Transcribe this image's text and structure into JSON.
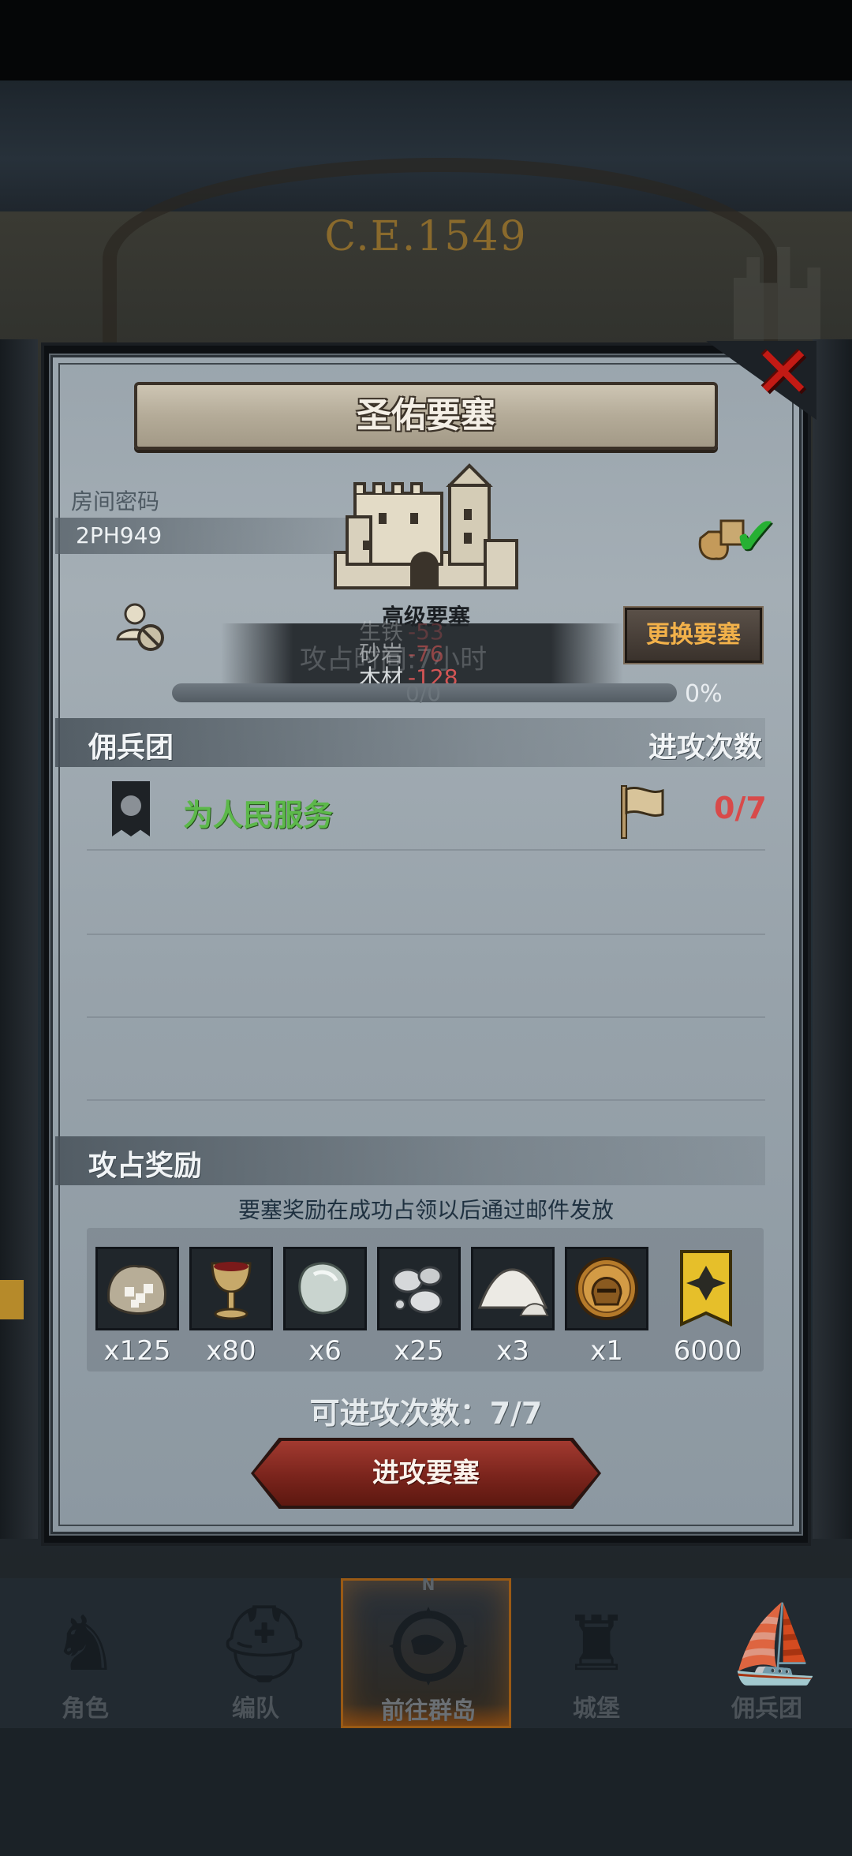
{
  "background": {
    "year_text": "C.E.1549"
  },
  "dialog": {
    "title": "圣佑要塞",
    "close_icon": "close-x-icon",
    "room_password_label": "房间密码",
    "room_password_value": "2PH949",
    "fortress_level_label": "高级要塞",
    "resources": [
      {
        "name": "生铁",
        "value": "-53"
      },
      {
        "name": "砂岩",
        "value": "-76"
      },
      {
        "name": "木材",
        "value": "-128"
      }
    ],
    "occupy_hint_text": "攻占时间:7小时",
    "swap_button_label": "更换要塞",
    "progress": {
      "text": "0/0",
      "percent_label": "0%",
      "fraction": 0
    },
    "mercenary_section": {
      "title": "佣兵团",
      "attack_count_title": "进攻次数",
      "items": [
        {
          "name": "为人民服务",
          "attack_count": "0/7"
        }
      ]
    },
    "rewards_section": {
      "title": "攻占奖励",
      "note": "要塞奖励在成功占领以后通过邮件发放",
      "items": [
        {
          "icon": "sugar-sack-icon",
          "qty": "x125"
        },
        {
          "icon": "wine-goblet-icon",
          "qty": "x80"
        },
        {
          "icon": "moonstone-icon",
          "qty": "x6"
        },
        {
          "icon": "silver-pearls-icon",
          "qty": "x25"
        },
        {
          "icon": "salt-pile-icon",
          "qty": "x3"
        },
        {
          "icon": "knight-helmet-medal-icon",
          "qty": "x1"
        },
        {
          "icon": "guild-banner-icon",
          "qty": "6000"
        }
      ]
    },
    "attacks_left_text": "可进攻次数：7/7",
    "attack_button_label": "进攻要塞"
  },
  "bottom_nav": {
    "compass_letter": "N",
    "items": [
      {
        "label": "角色",
        "icon": "knight-icon",
        "active": false
      },
      {
        "label": "编队",
        "icon": "helmet-icon",
        "active": false
      },
      {
        "label": "前往群岛",
        "icon": "compass-globe-icon",
        "active": true
      },
      {
        "label": "城堡",
        "icon": "castle-icon",
        "active": false
      },
      {
        "label": "佣兵团",
        "icon": "ship-icon",
        "active": false
      }
    ]
  },
  "colors": {
    "accent_orange": "#f2b14a",
    "negative_red": "#d35555",
    "guild_green": "#5cb84a",
    "attack_button": "#8f2e24"
  }
}
